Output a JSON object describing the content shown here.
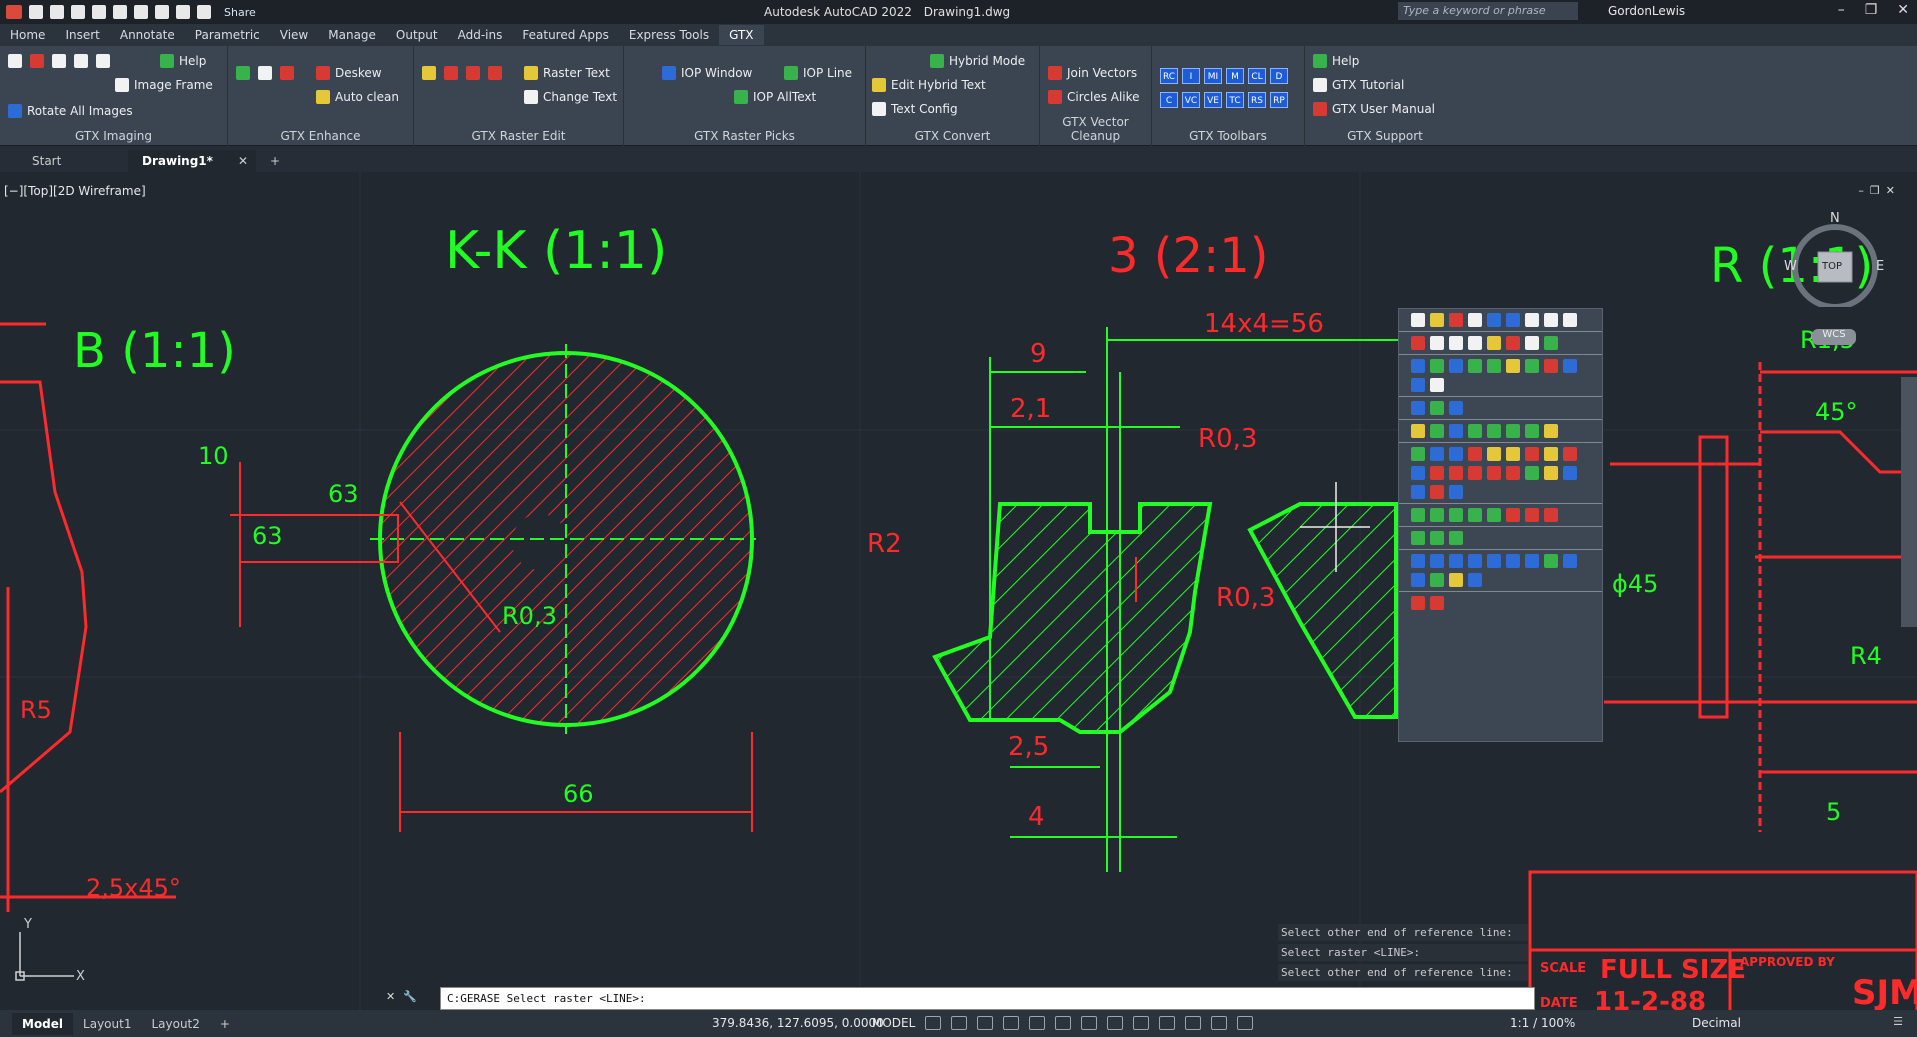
{
  "titlebar": {
    "app_name": "Autodesk AutoCAD 2022",
    "document": "Drawing1.dwg",
    "share_label": "Share",
    "search_placeholder": "Type a keyword or phrase",
    "user": "GordonLewis"
  },
  "ribbon_tabs": [
    "Home",
    "Insert",
    "Annotate",
    "Parametric",
    "View",
    "Manage",
    "Output",
    "Add-ins",
    "Featured Apps",
    "Express Tools",
    "GTX"
  ],
  "ribbon": {
    "panels": {
      "imaging": "GTX Imaging",
      "enhance": "GTX Enhance",
      "raster_edit": "GTX Raster Edit",
      "raster_picks": "GTX Raster Picks",
      "convert": "GTX Convert",
      "vector_cleanup": "GTX Vector Cleanup",
      "toolbars": "GTX Toolbars",
      "support": "GTX Support"
    },
    "buttons": {
      "help": "Help",
      "image_frame": "Image Frame",
      "rotate_all_images": "Rotate All Images",
      "deskew": "Deskew",
      "auto_clean": "Auto clean",
      "raster_text": "Raster Text",
      "change_text": "Change Text",
      "iop_window": "IOP Window",
      "iop_line": "IOP Line",
      "iop_alltext": "IOP AllText",
      "hybrid_mode": "Hybrid Mode",
      "edit_hybrid_text": "Edit Hybrid Text",
      "text_config": "Text Config",
      "join_vectors": "Join Vectors",
      "circles_alike": "Circles Alike",
      "support_help": "Help",
      "gtx_tutorial": "GTX Tutorial",
      "gtx_user_manual": "GTX User Manual"
    },
    "toolbar_codes": [
      "RC",
      "I",
      "MI",
      "M",
      "CL",
      "D",
      "C",
      "VC",
      "VE",
      "TC",
      "RS",
      "RP"
    ]
  },
  "doc_tabs": {
    "start": "Start",
    "drawing": "Drawing1*"
  },
  "viewport": {
    "label": "[−][Top][2D Wireframe]",
    "compass": {
      "n": "N",
      "w": "W",
      "e": "E",
      "top": "TOP",
      "wcs": "WCS"
    }
  },
  "drawing_text": {
    "kk": "K-K (1:1)",
    "b": "B (1:1)",
    "three": "3 (2:1)",
    "r11": "R (1:1)",
    "d10": "10",
    "d63a": "63",
    "d63b": "63",
    "r03a": "R0,3",
    "r5": "R5",
    "d66": "66",
    "c25": "2,5x45°",
    "d14": "14x4=56",
    "d9": "9",
    "d21": "2,1",
    "r03b": "R0,3",
    "r2": "R2",
    "r03c": "R0,3",
    "d25": "2,5",
    "d4": "4",
    "r15": "R1,5",
    "a45": "45°",
    "phi45": "ϕ45",
    "r4": "R4",
    "d5": "5",
    "scale_lbl": "SCALE",
    "scale_val": "FULL SIZE",
    "approved": "APPROVED BY",
    "date_lbl": "DATE",
    "date_val": "11-2-88",
    "initials": "SJM"
  },
  "command": {
    "history": [
      "Select other end of reference line:",
      "Select raster <LINE>:",
      "Select other end of reference line:"
    ],
    "current": "C:GERASE Select raster <LINE>:"
  },
  "status": {
    "model_tab": "Model",
    "layout1": "Layout1",
    "layout2": "Layout2",
    "coords": "379.8436, 127.6095, 0.0000",
    "mode": "MODEL",
    "scale": "1:1 / 100%",
    "units": "Decimal"
  },
  "colors": {
    "accent_red": "#ff2a2a",
    "accent_green": "#22ff22",
    "ribbon_bg": "#3b4552"
  }
}
